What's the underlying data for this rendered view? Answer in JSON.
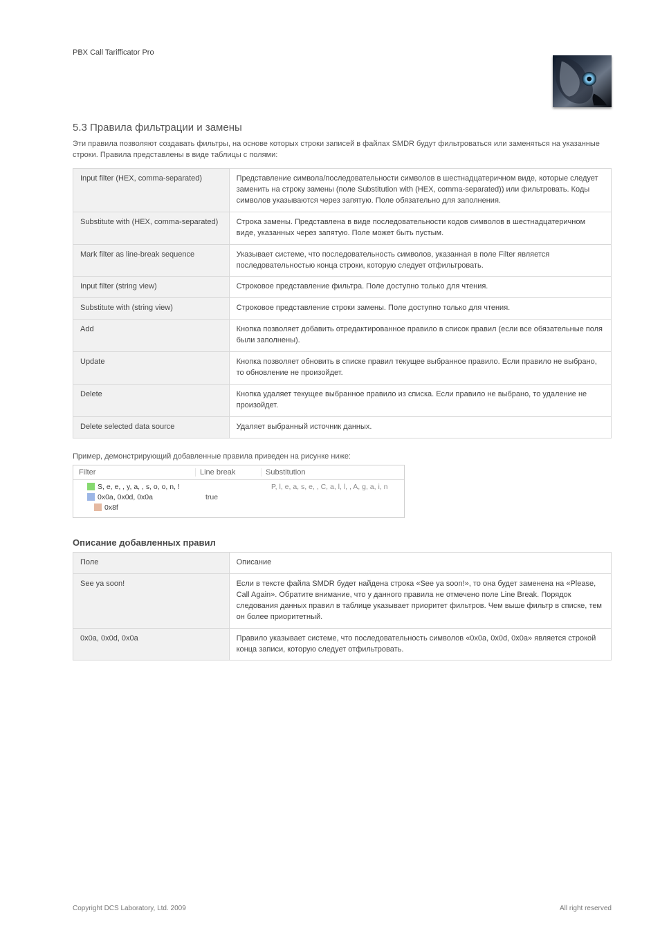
{
  "header": {
    "subtitle": "PBX Call Tarifficator Pro"
  },
  "section1": {
    "title": "5.3 Правила фильтрации и замены",
    "intro": "Эти правила позволяют создавать фильтры, на основе которых строки записей в файлах SMDR будут фильтроваться или заменяться на указанные строки. Правила представлены в виде таблицы с полями:",
    "rows": [
      {
        "k": "Input filter (HEX, comma-separated)",
        "v": "Представление символа/последовательности символов в шестнадцатеричном виде, которые следует заменить на строку замены (поле Substitution with (HEX, comma-separated)) или фильтровать. Коды символов указываются через запятую. Поле обязательно для заполнения."
      },
      {
        "k": "Substitute with (HEX, comma-separated)",
        "v": "Строка замены. Представлена в виде последовательности кодов символов в шестнадцатеричном виде, указанных через запятую. Поле может быть пустым."
      },
      {
        "k": "Mark filter as line-break sequence",
        "v": "Указывает системе, что последовательность символов, указанная в поле Filter является последовательностью конца строки, которую следует отфильтровать."
      },
      {
        "k": "Input filter (string view)",
        "v": "Строковое представление фильтра. Поле доступно только для чтения."
      },
      {
        "k": "Substitute with (string view)",
        "v": "Строковое представление строки замены. Поле доступно только для чтения."
      },
      {
        "k": "Add",
        "v": "Кнопка позволяет добавить отредактированное правило в список правил (если все обязательные поля были заполнены)."
      },
      {
        "k": "Update",
        "v": "Кнопка позволяет обновить в списке правил текущее выбранное правило. Если правило не выбрано, то обновление не произойдет."
      },
      {
        "k": "Delete",
        "v": "Кнопка удаляет текущее выбранное правило из списка. Если правило не выбрано, то удаление не произойдет."
      },
      {
        "k": "Delete selected data source",
        "v": "Удаляет выбранный источник данных."
      }
    ]
  },
  "example": {
    "lead": "Пример, демонстрирующий добавленные правила приведен на рисунке ниже:",
    "headers": {
      "filter": "Filter",
      "linebreak": "Line break",
      "substitution": "Substitution"
    },
    "rows": [
      {
        "swatch": "green",
        "filter": "S, e, e,  , y, a,  , s, o, o, n, !",
        "lb": "",
        "sub": "P, l, e, a, s, e,  , C, a, l, l,  , A, g, a, i, n"
      },
      {
        "swatch": "blue",
        "filter": "0x0a, 0x0d, 0x0a",
        "lb": "true",
        "sub": ""
      },
      {
        "swatch": "peach",
        "filter": "0x8f",
        "lb": "",
        "sub": ""
      }
    ]
  },
  "section2": {
    "title": "Описание добавленных правил",
    "headers": {
      "left": "Поле",
      "right": "Описание"
    },
    "rows": [
      {
        "k": "See ya soon!",
        "v": "Если в тексте файла SMDR будет найдена строка «See ya soon!», то она будет заменена на «Please, Call Again». Обратите внимание, что у данного правила не отмечено поле Line Break. Порядок следования данных правил в таблице указывает приоритет фильтров. Чем выше фильтр в списке, тем он более приоритетный."
      },
      {
        "k": "0x0a, 0x0d, 0x0a",
        "v": "Правило указывает системе, что последовательность символов «0x0a, 0x0d, 0x0a» является строкой конца записи, которую следует отфильтровать."
      }
    ]
  },
  "footer": {
    "left": "Copyright DCS Laboratory, Ltd. 2009",
    "right": "All right reserved"
  }
}
